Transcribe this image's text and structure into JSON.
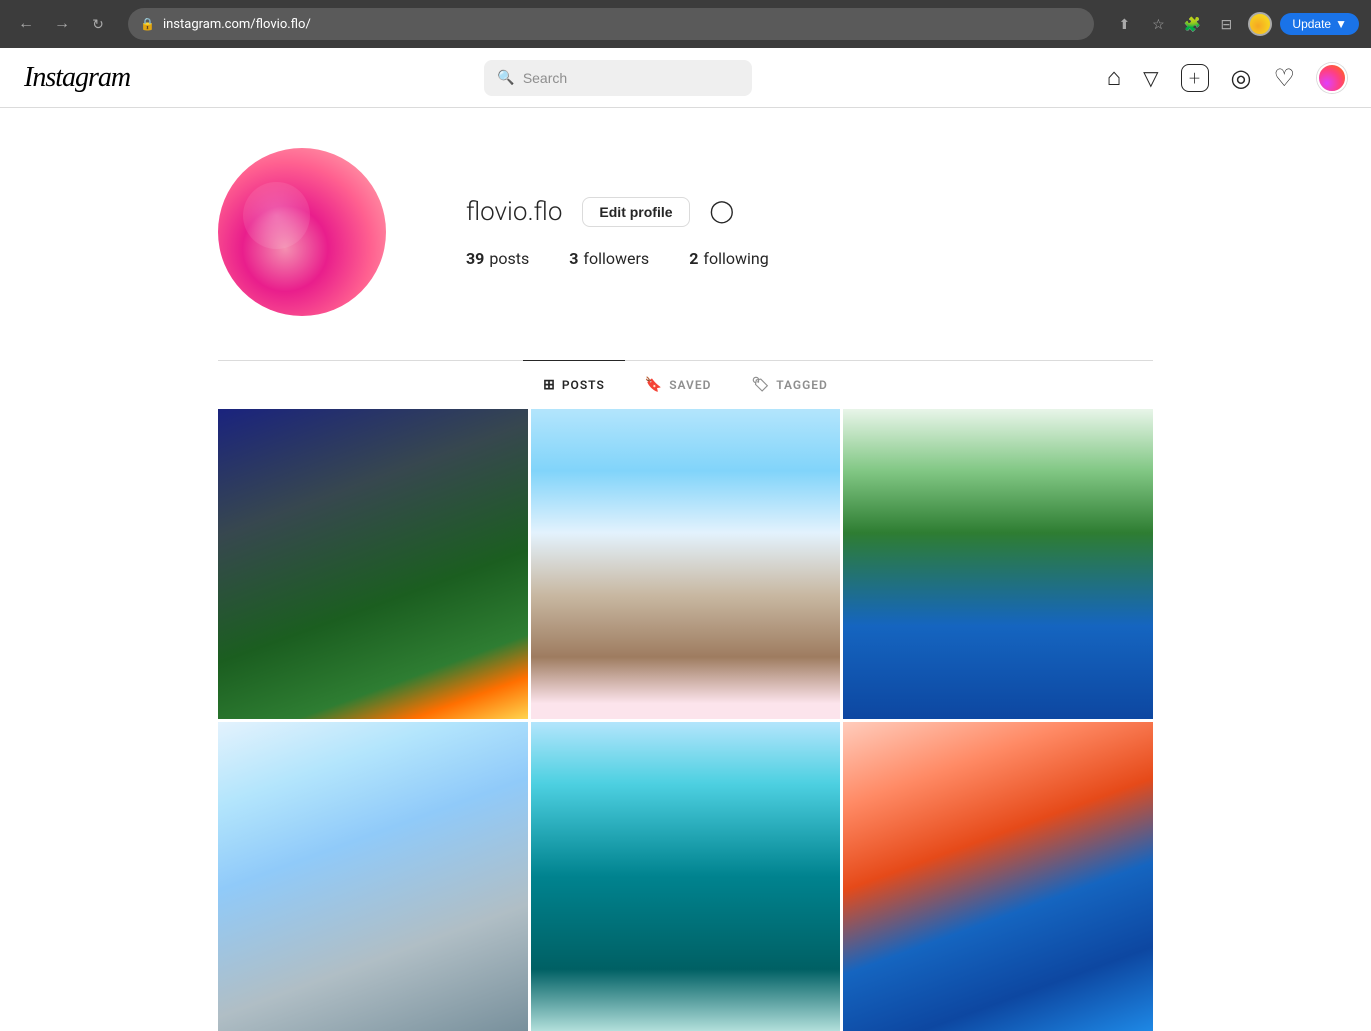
{
  "browser": {
    "url": "instagram.com/flovio.flo/",
    "back_label": "←",
    "forward_label": "→",
    "reload_label": "↻",
    "update_label": "Update",
    "extensions": [
      "puzzle-icon",
      "cast-icon",
      "profile-icon",
      "star-icon"
    ]
  },
  "header": {
    "logo": "Instagram",
    "search_placeholder": "Search",
    "nav_icons": {
      "home": "⌂",
      "filter": "▽",
      "add": "+",
      "compass": "◎",
      "heart": "♡"
    }
  },
  "profile": {
    "username": "flovio.flo",
    "edit_button": "Edit profile",
    "posts_count": "39",
    "posts_label": "posts",
    "followers_count": "3",
    "followers_label": "followers",
    "following_count": "2",
    "following_label": "following"
  },
  "tabs": [
    {
      "id": "posts",
      "label": "POSTS",
      "active": true
    },
    {
      "id": "saved",
      "label": "SAVED",
      "active": false
    },
    {
      "id": "tagged",
      "label": "TAGGED",
      "active": false
    }
  ],
  "photos": [
    {
      "id": "photo-1",
      "class": "photo-1"
    },
    {
      "id": "photo-2",
      "class": "photo-2"
    },
    {
      "id": "photo-3",
      "class": "photo-3"
    },
    {
      "id": "photo-4",
      "class": "photo-4"
    },
    {
      "id": "photo-5",
      "class": "photo-5"
    },
    {
      "id": "photo-6",
      "class": "photo-6"
    }
  ]
}
